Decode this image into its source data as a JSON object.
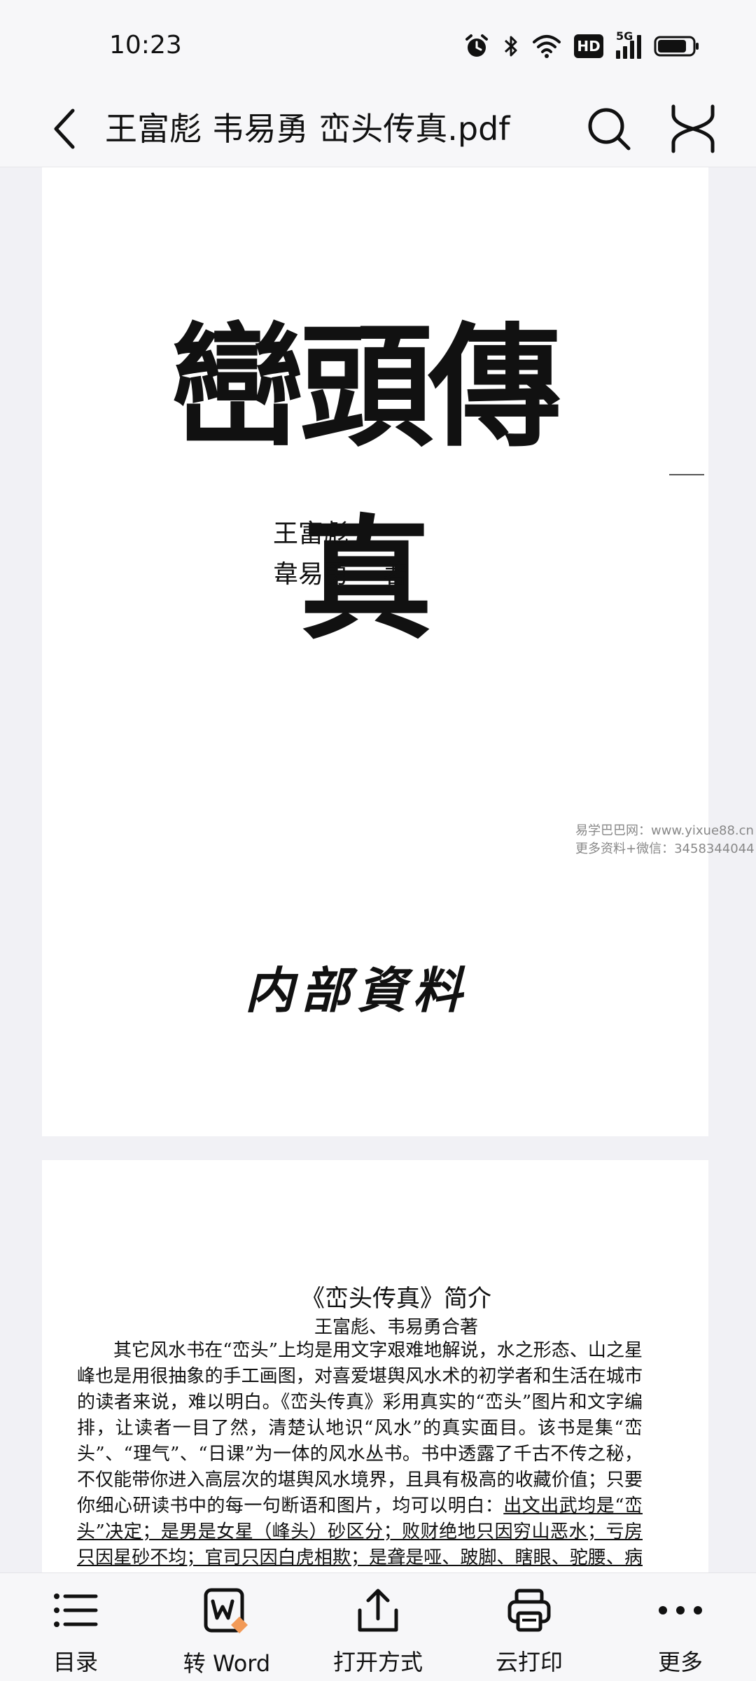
{
  "status": {
    "time": "10:23",
    "hd": "HD",
    "network": "5G"
  },
  "app_bar": {
    "title": "王富彪 韦易勇 峦头传真.pdf"
  },
  "cover_page": {
    "title": "巒頭傳真",
    "author_1": "王富彪",
    "author_2": "韋易勇",
    "author_role": "著",
    "internal_label": "内部資料"
  },
  "watermark": {
    "line_1": "易学巴巴网：www.yixue88.cn",
    "line_2": "更多资料+微信：3458344044"
  },
  "intro_page": {
    "heading": "《峦头传真》简介",
    "byline": "王富彪、韦易勇合著",
    "body_plain": "其它风水书在“峦头”上均是用文字艰难地解说，水之形态、山之星峰也是用很抽象的手工画图，对喜爱堪舆风水术的初学者和生活在城市的读者来说，难以明白。《峦头传真》彩用真实的“峦头”图片和文字编排，让读者一目了然，清楚认地识“风水”的真实面目。该书是集“峦头”、“理气”、“日课”为一体的风水丛书。书中透露了千古不传之秘，不仅能带你进入高层次的堪舆风水境界，且具有极高的收藏价值；只要你细心研读书中的每一句断语和图片，均可以明白：",
    "body_underlined": "出文出武均是“峦头”决定；是男是女星（峰头）砂区分；败财绝地只因穷山恶水；亏房只因星砂不均；官司只因白虎相欺；是聋是哑、跛脚、瞎眼、驼腰、病子均是星砂上载"
  },
  "toolbar": {
    "items": [
      {
        "label": "目录",
        "icon": "list-icon"
      },
      {
        "label": "转 Word",
        "icon": "convert-word-icon"
      },
      {
        "label": "打开方式",
        "icon": "share-icon"
      },
      {
        "label": "云打印",
        "icon": "printer-icon"
      },
      {
        "label": "更多",
        "icon": "more-icon"
      }
    ]
  }
}
